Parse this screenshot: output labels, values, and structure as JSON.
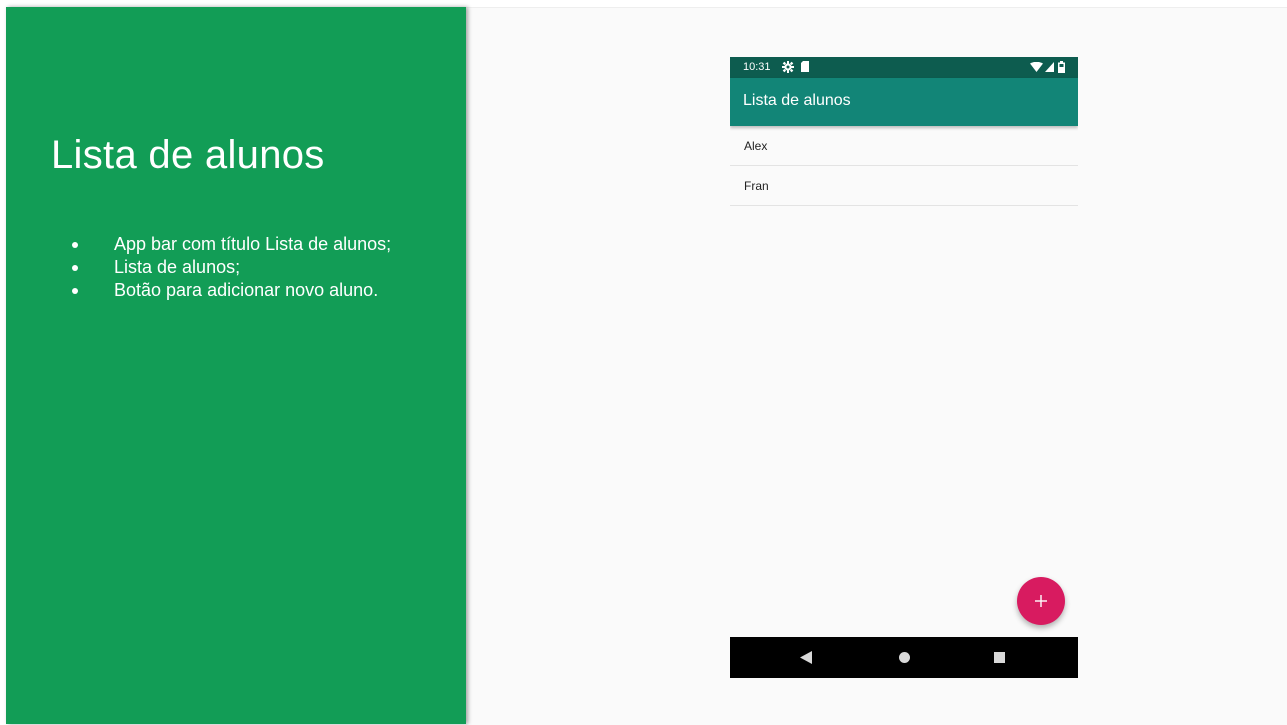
{
  "slide": {
    "title": "Lista de alunos",
    "bullets": [
      "App bar com título Lista de alunos;",
      "Lista de alunos;",
      "Botão para adicionar novo aluno."
    ]
  },
  "phone": {
    "status_bar": {
      "time": "10:31",
      "icons": [
        "gear-icon",
        "sd-card-icon",
        "wifi-icon",
        "signal-icon",
        "battery-icon"
      ]
    },
    "app_bar": {
      "title": "Lista de alunos"
    },
    "students": [
      "Alex",
      "Fran"
    ],
    "fab": {
      "icon": "plus-icon"
    },
    "nav_bar": {
      "icons": [
        "back-icon",
        "home-icon",
        "recents-icon"
      ]
    }
  },
  "colors": {
    "slide_green": "#129d56",
    "app_bar": "#128577",
    "status_bar": "#0d5c4f",
    "fab": "#d81b60"
  }
}
